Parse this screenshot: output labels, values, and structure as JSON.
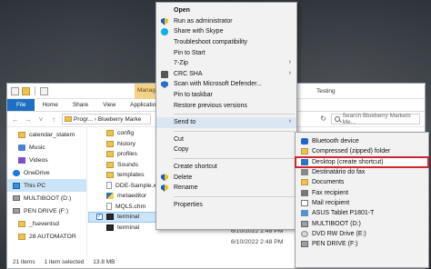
{
  "explorer": {
    "ribbon_tabs": [
      "File",
      "Home",
      "Share",
      "View",
      "Application Tools"
    ],
    "manage_tab": "Manage",
    "title_fragment": "Testing",
    "address_path": "Progr... › Blueberry Marke",
    "search_placeholder": "Search Blueberry Markets Me...",
    "nav_items": [
      {
        "label": "calendar_statem",
        "icon": "folder-icon"
      },
      {
        "label": "Music",
        "icon": "music-icon"
      },
      {
        "label": "Videos",
        "icon": "video-icon"
      },
      {
        "label": "OneDrive",
        "icon": "cloud-icon"
      },
      {
        "label": "This PC",
        "icon": "pc-icon"
      },
      {
        "label": "MULTIBOOT (D:)",
        "icon": "drive-icon"
      },
      {
        "label": "PEN DRIVE (F:)",
        "icon": "drive-icon"
      },
      {
        "label": "_fseventsd",
        "icon": "folder-icon"
      },
      {
        "label": "28 AUTOMATOR",
        "icon": "folder-icon"
      }
    ],
    "files": [
      {
        "name": "config",
        "icon": "folder-icon"
      },
      {
        "name": "history",
        "icon": "folder-icon"
      },
      {
        "name": "profiles",
        "icon": "folder-icon"
      },
      {
        "name": "Sounds",
        "icon": "folder-icon"
      },
      {
        "name": "templates",
        "icon": "folder-icon"
      },
      {
        "name": "DDE-Sample.x",
        "icon": "document-icon"
      },
      {
        "name": "metaeditor",
        "icon": "document-icon"
      },
      {
        "name": "MQL5.chm",
        "icon": "document-icon"
      },
      {
        "name": "terminal",
        "icon": "terminal-icon"
      },
      {
        "name": "terminal",
        "icon": "terminal-icon"
      }
    ],
    "dates": [
      "6/10/2022 2:48 PM",
      "6/10/2022 2:48 PM"
    ],
    "status": {
      "items": "21 items",
      "selected": "1 item selected",
      "size": "13.8 MB"
    }
  },
  "context_menu": {
    "groups": [
      [
        {
          "label": "Open",
          "bold": true
        },
        {
          "label": "Run as administrator",
          "icon": "shield-icon"
        },
        {
          "label": "Share with Skype",
          "icon": "skype-icon"
        },
        {
          "label": "Troubleshoot compatibility"
        },
        {
          "label": "Pin to Start"
        },
        {
          "label": "7-Zip",
          "arrow": true
        },
        {
          "label": "CRC SHA",
          "arrow": true,
          "icon": "crc-icon"
        },
        {
          "label": "Scan with Microsoft Defender...",
          "icon": "defender-icon"
        },
        {
          "label": "Pin to taskbar"
        },
        {
          "label": "Restore previous versions"
        }
      ],
      [
        {
          "label": "Send to",
          "arrow": true,
          "hover": true
        }
      ],
      [
        {
          "label": "Cut"
        },
        {
          "label": "Copy"
        }
      ],
      [
        {
          "label": "Create shortcut"
        },
        {
          "label": "Delete",
          "icon": "shield-icon"
        },
        {
          "label": "Rename",
          "icon": "shield-icon"
        }
      ],
      [
        {
          "label": "Properties"
        }
      ]
    ]
  },
  "send_to_menu": [
    {
      "label": "Bluetooth device",
      "icon": "bluetooth-icon"
    },
    {
      "label": "Compressed (zipped) folder",
      "icon": "zip-folder-icon"
    },
    {
      "label": "Desktop (create shortcut)",
      "icon": "desktop-icon",
      "highlight": true
    },
    {
      "label": "Destinatário do fax",
      "icon": "fax-destination-icon"
    },
    {
      "label": "Documents",
      "icon": "documents-icon"
    },
    {
      "label": "Fax recipient",
      "icon": "fax-icon"
    },
    {
      "label": "Mail recipient",
      "icon": "mail-icon"
    },
    {
      "label": "ASUS Tablet P1801-T",
      "icon": "tablet-icon"
    },
    {
      "label": "MULTIBOOT (D:)",
      "icon": "usb-drive-icon"
    },
    {
      "label": "DVD RW Drive (E:)",
      "icon": "dvd-icon"
    },
    {
      "label": "PEN DRIVE (F:)",
      "icon": "usb-drive-icon"
    }
  ],
  "colors": {
    "highlight_border": "#d3252f",
    "selection": "#cce4f7",
    "file_tab": "#1c6fc3",
    "manage_tab": "#f2d28a"
  }
}
